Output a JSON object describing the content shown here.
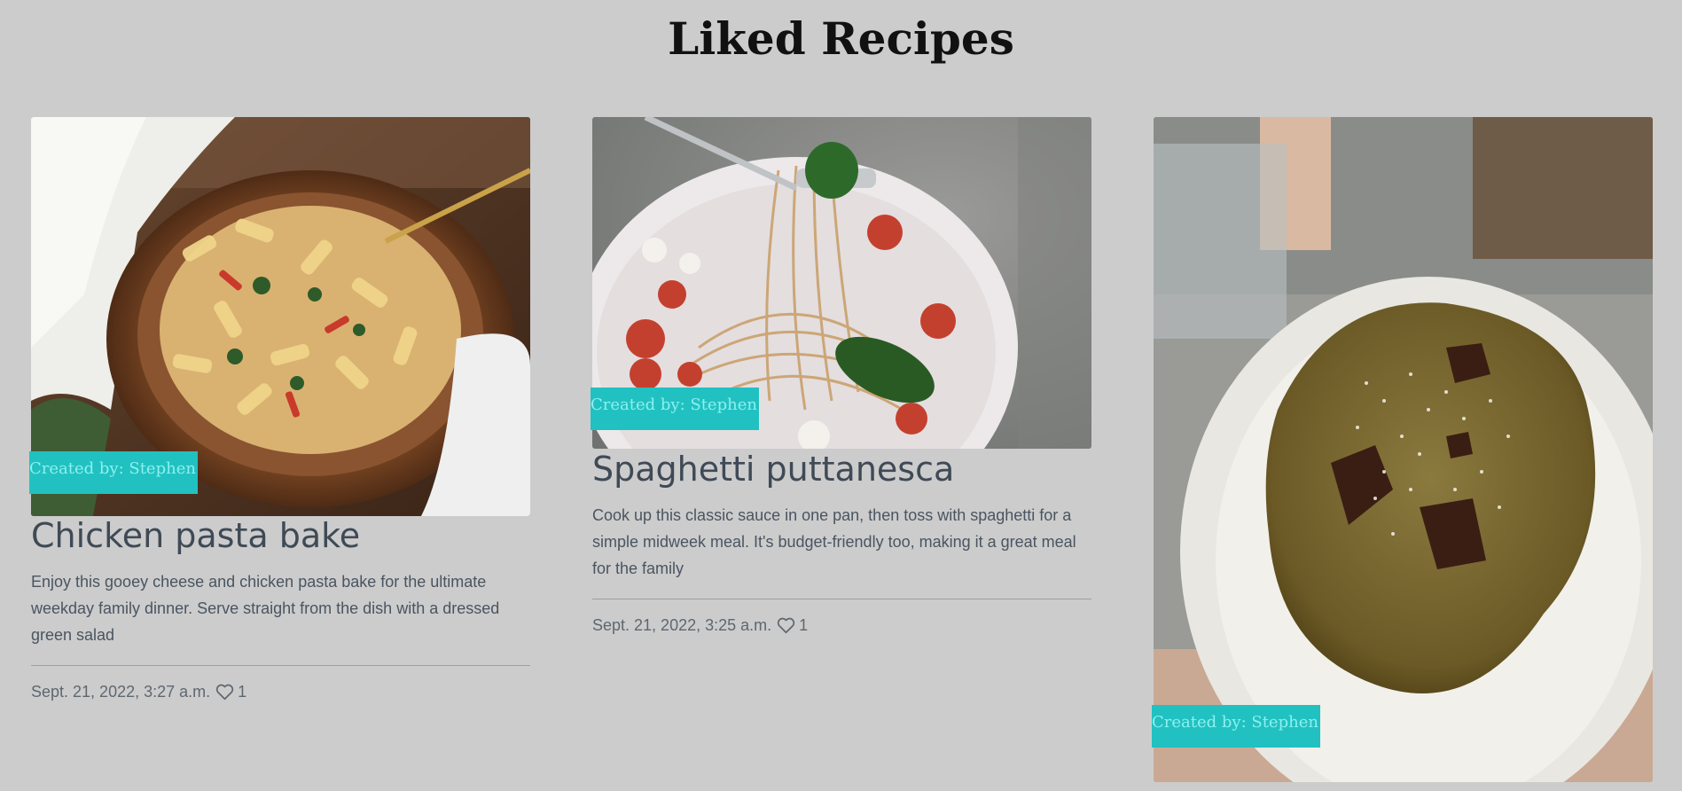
{
  "page": {
    "title": "Liked Recipes"
  },
  "recipes": [
    {
      "creator": "Created by: Stephen",
      "title": "Chicken pasta bake",
      "description": "Enjoy this gooey cheese and chicken pasta bake for the ultimate weekday family dinner. Serve straight from the dish with a dressed green salad",
      "date": "Sept. 21, 2022, 3:27 a.m.",
      "likes": "1",
      "like_icon": "heart-outline-icon"
    },
    {
      "creator": "Created by: Stephen",
      "title": "Spaghetti puttanesca",
      "description": "Cook up this classic sauce in one pan, then toss with spaghetti for a simple midweek meal. It's budget-friendly too, making it a great meal for the family",
      "date": "Sept. 21, 2022, 3:25 a.m.",
      "likes": "1",
      "like_icon": "heart-outline-icon"
    },
    {
      "creator": "Created by: Stephen"
    }
  ],
  "colors": {
    "background": "#cccccc",
    "badge_bg": "#21c1c1",
    "badge_text": "#8df0ef",
    "title_text": "#3f4a56"
  }
}
